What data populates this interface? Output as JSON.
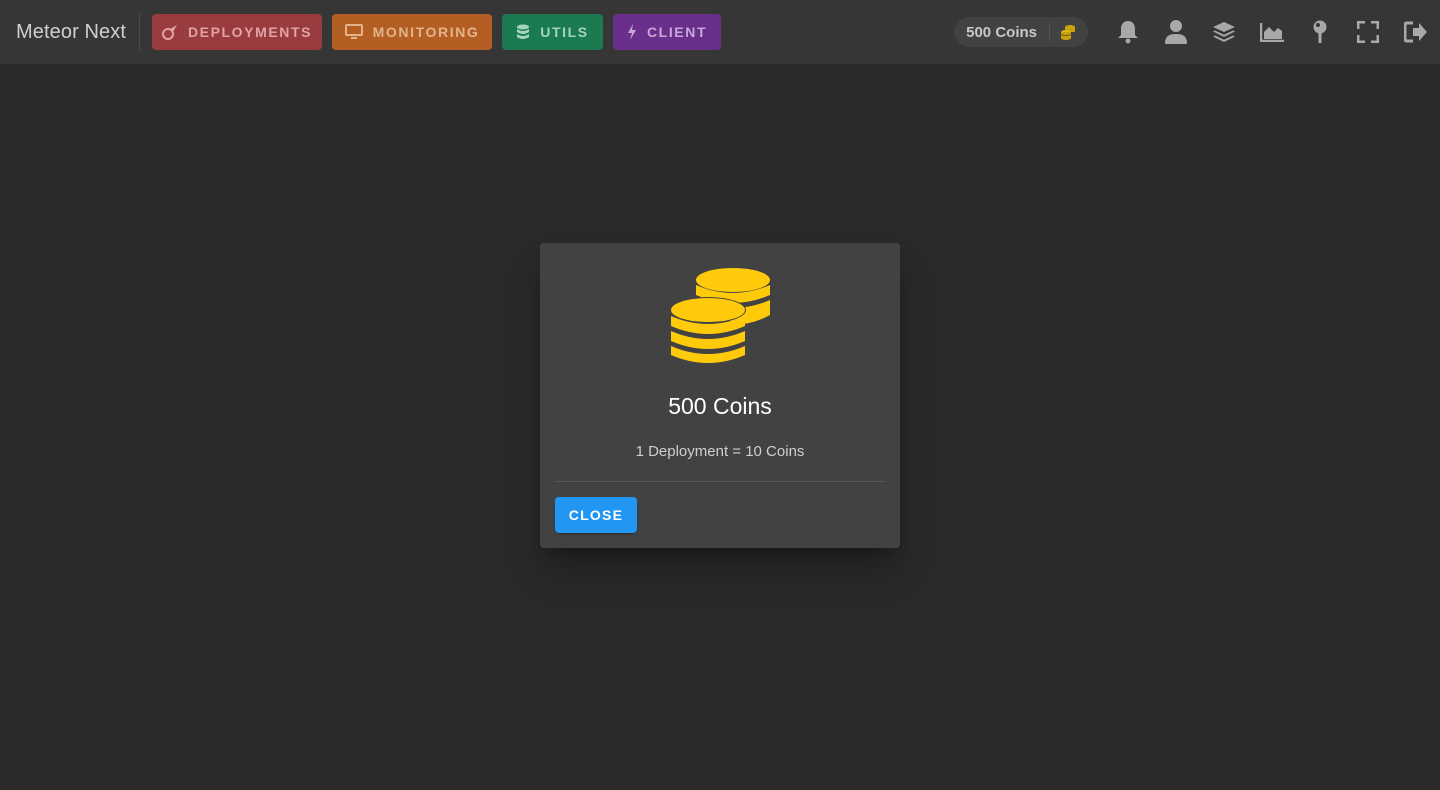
{
  "app": {
    "title": "Meteor Next"
  },
  "nav": {
    "deployments": {
      "label": "DEPLOYMENTS",
      "bg": "#9a3b40",
      "fg": "#e0a3a5",
      "icon": "meteor-icon"
    },
    "monitoring": {
      "label": "MONITORING",
      "bg": "#b35e23",
      "fg": "#e3b38d",
      "icon": "desktop-icon"
    },
    "utils": {
      "label": "UTILS",
      "bg": "#1b7a4f",
      "fg": "#a3d6bc",
      "icon": "database-icon"
    },
    "client": {
      "label": "CLIENT",
      "bg": "#6a2f8a",
      "fg": "#c9a7dc",
      "icon": "bolt-icon"
    }
  },
  "coins_chip": {
    "label": "500 Coins",
    "icon": "coins-icon"
  },
  "toolbar_icons": [
    "bell-icon",
    "user-icon",
    "layers-icon",
    "chart-area-icon",
    "pin-icon",
    "fullscreen-icon",
    "logout-icon"
  ],
  "dialog": {
    "icon": "coins-icon",
    "title": "500 Coins",
    "subtitle": "1 Deployment = 10 Coins",
    "close_label": "CLOSE"
  },
  "colors": {
    "accent": "#2196f3",
    "coin": "#ffca0a",
    "icon": "#a8a8a8"
  }
}
